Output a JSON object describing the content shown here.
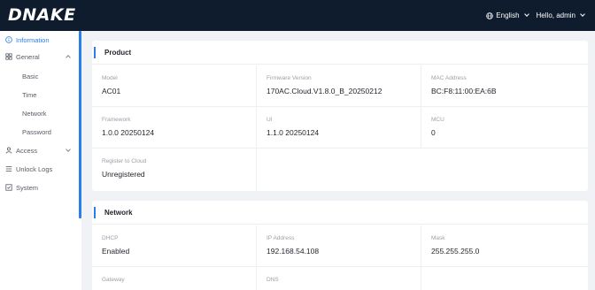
{
  "brand": {
    "logo_text": "DNAKE"
  },
  "header": {
    "language_label": "English",
    "user_label": "Hello, admin"
  },
  "sidebar": {
    "items": [
      {
        "label": "Information",
        "icon": "info-circle-icon",
        "active": true
      },
      {
        "label": "General",
        "icon": "grid-icon",
        "expanded": true
      },
      {
        "label": "Basic"
      },
      {
        "label": "Time"
      },
      {
        "label": "Network"
      },
      {
        "label": "Password"
      },
      {
        "label": "Access",
        "icon": "user-icon",
        "expanded": false
      },
      {
        "label": "Unlock Logs",
        "icon": "list-icon"
      },
      {
        "label": "System",
        "icon": "system-icon"
      }
    ]
  },
  "product": {
    "title": "Product",
    "fields": [
      {
        "label": "Model",
        "value": "AC01"
      },
      {
        "label": "Firmware Version",
        "value": "170AC.Cloud.V1.8.0_B_20250212"
      },
      {
        "label": "MAC Address",
        "value": "BC:F8:11:00:EA:6B"
      },
      {
        "label": "Framework",
        "value": "1.0.0 20250124"
      },
      {
        "label": "UI",
        "value": "1.1.0 20250124"
      },
      {
        "label": "MCU",
        "value": "0"
      },
      {
        "label": "Register to Cloud",
        "value": "Unregistered"
      }
    ]
  },
  "network": {
    "title": "Network",
    "fields": [
      {
        "label": "DHCP",
        "value": "Enabled"
      },
      {
        "label": "IP Address",
        "value": "192.168.54.108"
      },
      {
        "label": "Mask",
        "value": "255.255.255.0"
      },
      {
        "label": "Gateway",
        "value": ""
      },
      {
        "label": "DNS",
        "value": ""
      }
    ]
  },
  "colors": {
    "accent": "#2b7de9",
    "topbar": "#0f1c2d",
    "background": "#f0f2f5"
  }
}
